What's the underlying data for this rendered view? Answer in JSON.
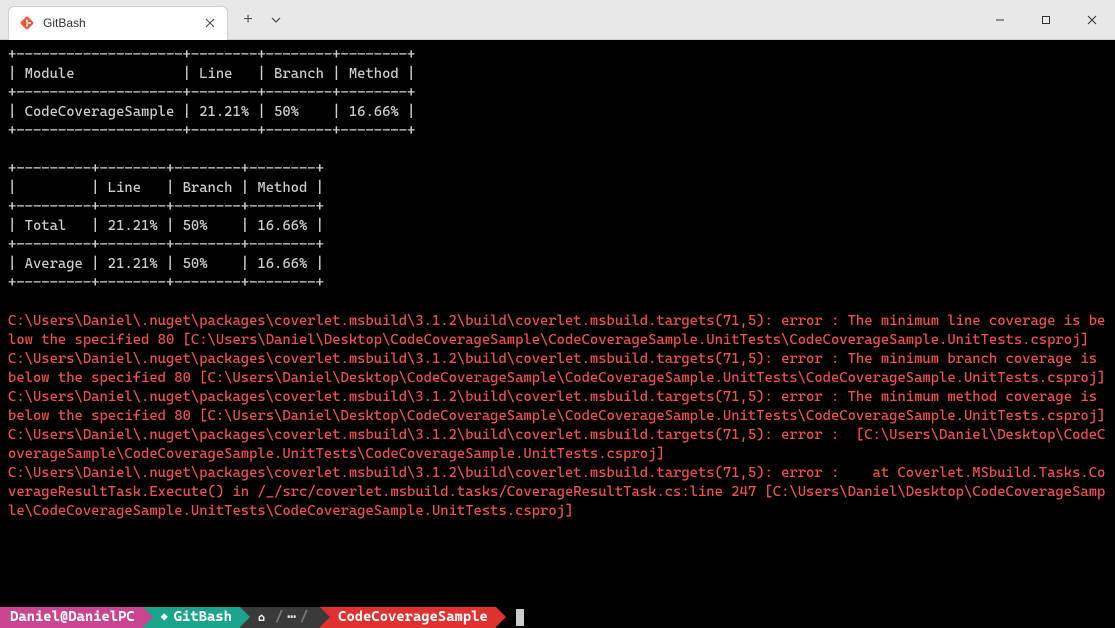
{
  "window": {
    "tab_title": "GitBash"
  },
  "terminal": {
    "table1": {
      "sep_top": "+--------------------+--------+--------+--------+",
      "header": "| Module             | Line   | Branch | Method |",
      "sep_mid": "+--------------------+--------+--------+--------+",
      "row": "| CodeCoverageSample | 21.21% | 50%    | 16.66% |",
      "sep_bot": "+--------------------+--------+--------+--------+"
    },
    "table2": {
      "sep_top": "+---------+--------+--------+--------+",
      "header": "|         | Line   | Branch | Method |",
      "sep_mid1": "+---------+--------+--------+--------+",
      "row_total": "| Total   | 21.21% | 50%    | 16.66% |",
      "sep_mid2": "+---------+--------+--------+--------+",
      "row_avg": "| Average | 21.21% | 50%    | 16.66% |",
      "sep_bot": "+---------+--------+--------+--------+"
    },
    "errors": {
      "e1": "C:\\Users\\Daniel\\.nuget\\packages\\coverlet.msbuild\\3.1.2\\build\\coverlet.msbuild.targets(71,5): error : The minimum line coverage is below the specified 80 [C:\\Users\\Daniel\\Desktop\\CodeCoverageSample\\CodeCoverageSample.UnitTests\\CodeCoverageSample.UnitTests.csproj]",
      "e2": "C:\\Users\\Daniel\\.nuget\\packages\\coverlet.msbuild\\3.1.2\\build\\coverlet.msbuild.targets(71,5): error : The minimum branch coverage is below the specified 80 [C:\\Users\\Daniel\\Desktop\\CodeCoverageSample\\CodeCoverageSample.UnitTests\\CodeCoverageSample.UnitTests.csproj]",
      "e3": "C:\\Users\\Daniel\\.nuget\\packages\\coverlet.msbuild\\3.1.2\\build\\coverlet.msbuild.targets(71,5): error : The minimum method coverage is below the specified 80 [C:\\Users\\Daniel\\Desktop\\CodeCoverageSample\\CodeCoverageSample.UnitTests\\CodeCoverageSample.UnitTests.csproj]",
      "e4": "C:\\Users\\Daniel\\.nuget\\packages\\coverlet.msbuild\\3.1.2\\build\\coverlet.msbuild.targets(71,5): error :  [C:\\Users\\Daniel\\Desktop\\CodeCoverageSample\\CodeCoverageSample.UnitTests\\CodeCoverageSample.UnitTests.csproj]",
      "e5": "C:\\Users\\Daniel\\.nuget\\packages\\coverlet.msbuild\\3.1.2\\build\\coverlet.msbuild.targets(71,5): error :    at Coverlet.MSbuild.Tasks.CoverageResultTask.Execute() in /_/src/coverlet.msbuild.tasks/CoverageResultTask.cs:line 247 [C:\\Users\\Daniel\\Desktop\\CodeCoverageSample\\CodeCoverageSample.UnitTests\\CodeCoverageSample.UnitTests.csproj]"
    }
  },
  "prompt": {
    "user_host": "Daniel@DanielPC",
    "shell": "GitBash",
    "ellipsis": "⋯",
    "cwd": "CodeCoverageSample"
  }
}
